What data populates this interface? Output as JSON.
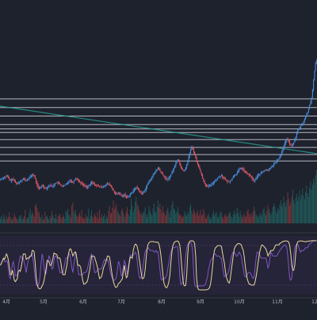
{
  "chart_data": {
    "type": "candlestick",
    "x_tick_labels": [
      "4月",
      "5月",
      "6月",
      "7月",
      "8月",
      "9月",
      "10月",
      "11月",
      "12"
    ],
    "price": [
      56,
      57,
      58,
      59,
      58.5,
      59.5,
      61,
      60,
      58,
      56,
      54,
      55,
      56.5,
      55.5,
      54,
      52,
      51,
      50,
      51.5,
      53,
      54,
      55,
      56,
      57,
      56,
      55,
      54,
      56,
      57,
      58,
      60,
      61,
      63,
      62,
      60,
      57,
      52,
      48,
      45,
      43,
      44,
      46,
      48,
      47,
      45,
      44,
      43.5,
      45,
      46,
      47.5,
      48,
      47,
      46,
      47,
      49,
      50,
      51,
      52,
      51,
      50,
      49,
      48,
      47,
      46,
      47,
      48,
      49,
      50,
      52,
      54,
      55,
      54,
      53,
      52,
      54,
      56,
      58,
      57,
      55,
      54,
      53,
      51,
      50,
      49,
      48,
      47,
      46,
      45.5,
      46,
      47,
      48,
      50,
      52,
      51,
      50,
      49,
      48,
      47.5,
      47,
      46.5,
      46,
      45.5,
      45,
      46,
      47,
      47.5,
      48,
      49,
      50,
      49.5,
      48.5,
      47,
      45,
      42.5,
      40,
      38,
      36,
      35,
      36,
      37.5,
      36,
      34.5,
      33,
      32,
      33.5,
      35,
      33,
      32,
      31,
      32.5,
      34,
      35.5,
      37,
      38,
      40,
      42,
      44,
      45,
      44,
      42,
      40,
      38,
      37,
      36,
      38,
      40,
      42,
      45,
      48,
      51,
      53,
      55,
      58,
      60,
      62,
      64,
      66,
      69,
      70,
      72,
      71,
      68,
      66,
      64,
      62,
      60,
      58,
      57,
      56,
      57,
      58,
      60,
      63,
      66,
      69,
      72,
      75,
      79,
      82,
      84,
      81,
      77,
      74,
      71,
      69,
      68,
      70,
      73,
      77,
      82,
      88,
      93,
      98,
      101,
      99,
      95,
      91,
      86,
      82,
      78,
      74,
      70,
      66,
      62,
      58,
      54,
      51,
      48,
      47,
      46,
      46.5,
      47,
      48,
      49,
      50,
      52,
      54,
      55,
      56,
      58,
      59,
      60,
      61,
      62,
      60,
      58,
      57,
      55.5,
      54,
      53,
      52.5,
      53,
      54,
      56,
      58,
      60,
      62,
      63,
      64,
      66,
      68,
      70,
      71,
      72,
      71,
      70,
      68,
      66,
      65,
      64,
      63,
      62,
      61,
      59,
      57,
      55,
      54,
      56,
      58,
      60,
      62,
      63,
      64,
      65,
      66,
      67,
      68,
      69,
      70,
      69,
      68,
      70,
      72,
      74,
      75,
      76,
      78,
      79,
      80,
      82,
      84,
      86,
      89,
      92,
      95,
      99,
      103,
      107,
      110,
      112,
      111,
      109,
      106,
      104,
      103,
      105,
      108,
      112,
      116,
      121,
      125,
      126,
      128,
      131,
      133,
      135,
      138,
      141,
      144,
      147,
      150,
      155,
      160,
      165,
      171,
      182,
      195,
      208,
      218,
      222
    ],
    "volume": [
      18,
      26,
      14,
      32,
      21,
      12,
      28,
      16,
      24,
      40,
      22,
      18,
      11,
      20,
      35,
      24,
      19,
      13,
      16,
      28,
      22,
      31,
      14,
      18,
      26,
      48,
      15,
      19,
      22,
      38,
      52,
      29,
      41,
      33,
      25,
      62,
      70,
      55,
      44,
      38,
      22,
      19,
      31,
      12,
      15,
      41,
      23,
      28,
      18,
      13,
      26,
      20,
      44,
      30,
      21,
      17,
      34,
      14,
      26,
      29,
      35,
      22,
      19,
      30,
      24,
      17,
      45,
      38,
      51,
      28,
      33,
      21,
      62,
      74,
      44,
      35,
      48,
      27,
      22,
      30,
      39,
      26,
      48,
      22,
      15,
      18,
      33,
      20,
      25,
      52,
      17,
      28,
      46,
      24,
      19,
      35,
      27,
      21,
      40,
      16,
      48,
      22,
      33,
      18,
      26,
      35,
      14,
      27,
      19,
      44,
      62,
      35,
      38,
      55,
      82,
      49,
      58,
      70,
      44,
      39,
      32,
      27,
      45,
      53,
      38,
      22,
      31,
      42,
      58,
      34,
      26,
      49,
      88,
      63,
      40,
      52,
      77,
      94,
      70,
      61,
      48,
      33,
      40,
      29,
      37,
      44,
      58,
      31,
      22,
      36,
      63,
      47,
      35,
      29,
      53,
      71,
      44,
      38,
      60,
      82,
      55,
      70,
      49,
      35,
      62,
      41,
      33,
      28,
      46,
      57,
      38,
      21,
      45,
      66,
      79,
      53,
      48,
      35,
      42,
      58,
      36,
      28,
      33,
      24,
      19,
      28,
      44,
      32,
      26,
      41,
      35,
      57,
      68,
      45,
      33,
      51,
      42,
      30,
      38,
      46,
      25,
      34,
      48,
      29,
      31,
      52,
      38,
      21,
      17,
      28,
      36,
      24,
      15,
      20,
      33,
      46,
      27,
      36,
      40,
      23,
      19,
      30,
      42,
      38,
      24,
      17,
      28,
      35,
      22,
      26,
      31,
      41,
      37,
      25,
      19,
      33,
      46,
      29,
      38,
      57,
      36,
      24,
      45,
      30,
      18,
      27,
      36,
      22,
      26,
      44,
      50,
      34,
      23,
      38,
      29,
      41,
      60,
      46,
      32,
      28,
      20,
      28,
      39,
      25,
      33,
      48,
      58,
      37,
      29,
      45,
      66,
      52,
      38,
      30,
      41,
      58,
      71,
      62,
      44,
      36,
      55,
      48,
      68,
      82,
      61,
      70,
      96,
      74,
      59,
      83,
      112,
      88,
      64,
      76,
      95,
      120,
      84,
      70,
      92,
      105,
      80,
      96,
      118,
      87,
      102,
      124,
      98,
      86,
      112,
      136,
      108,
      95,
      128,
      150,
      120,
      138,
      160,
      145,
      172,
      190
    ],
    "h_levels": [
      82,
      91,
      101,
      112,
      122,
      127,
      133,
      145,
      157,
      169
    ],
    "horizontal_level_count": 10
  }
}
